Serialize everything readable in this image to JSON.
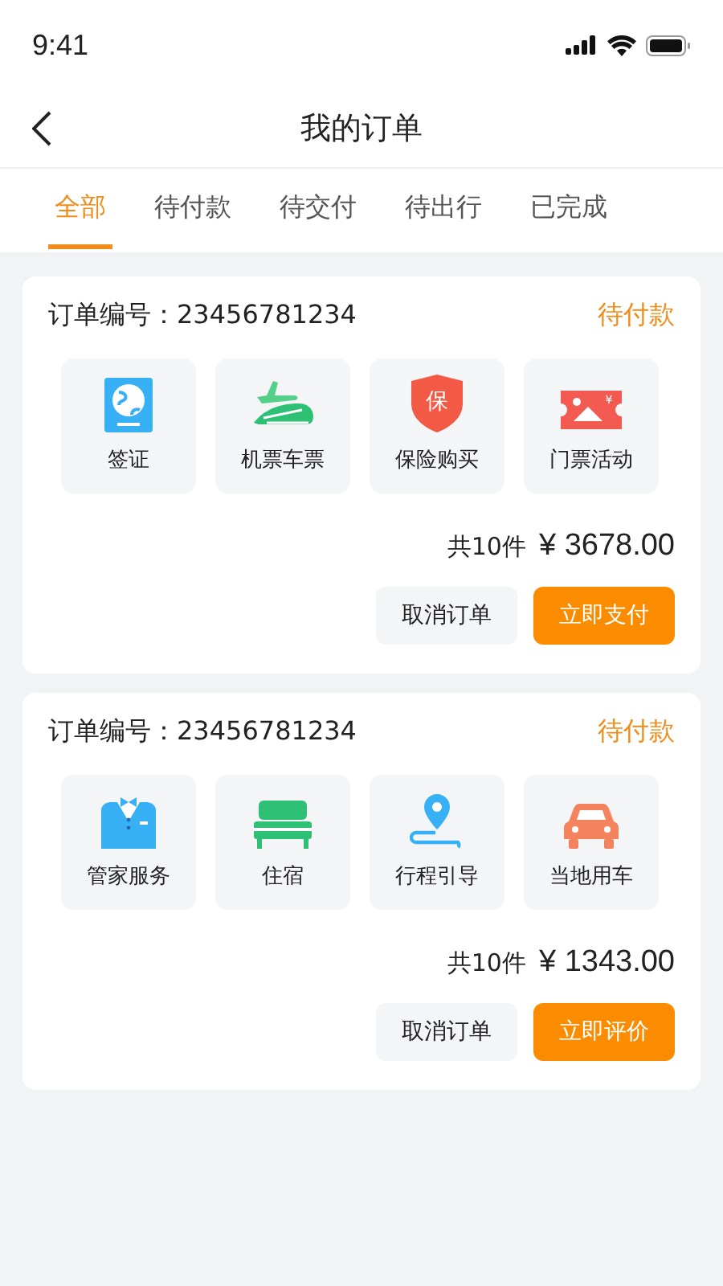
{
  "status_bar": {
    "time": "9:41"
  },
  "nav": {
    "title": "我的订单"
  },
  "tabs": [
    {
      "label": "全部",
      "selected": true
    },
    {
      "label": "待付款",
      "selected": false
    },
    {
      "label": "待交付",
      "selected": false
    },
    {
      "label": "待出行",
      "selected": false
    },
    {
      "label": "已完成",
      "selected": false
    }
  ],
  "orders": [
    {
      "number_label": "订单编号：",
      "number": "23456781234",
      "status": "待付款",
      "items": [
        {
          "kind": "visa",
          "label": "签证"
        },
        {
          "kind": "transport",
          "label": "机票车票"
        },
        {
          "kind": "insurance",
          "label": "保险购买",
          "icon_text": "保"
        },
        {
          "kind": "ticket",
          "label": "门票活动",
          "icon_text": "¥"
        }
      ],
      "count": "共10件",
      "price": "¥ 3678.00",
      "buttons": [
        {
          "label": "取消订单",
          "kind": "secondary"
        },
        {
          "label": "立即支付",
          "kind": "primary"
        }
      ]
    },
    {
      "number_label": "订单编号：",
      "number": "23456781234",
      "status": "待付款",
      "items": [
        {
          "kind": "butler",
          "label": "管家服务"
        },
        {
          "kind": "bed",
          "label": "住宿"
        },
        {
          "kind": "route",
          "label": "行程引导"
        },
        {
          "kind": "car",
          "label": "当地用车"
        }
      ],
      "count": "共10件",
      "price": "¥ 1343.00",
      "buttons": [
        {
          "label": "取消订单",
          "kind": "secondary"
        },
        {
          "label": "立即评价",
          "kind": "primary"
        }
      ]
    }
  ]
}
